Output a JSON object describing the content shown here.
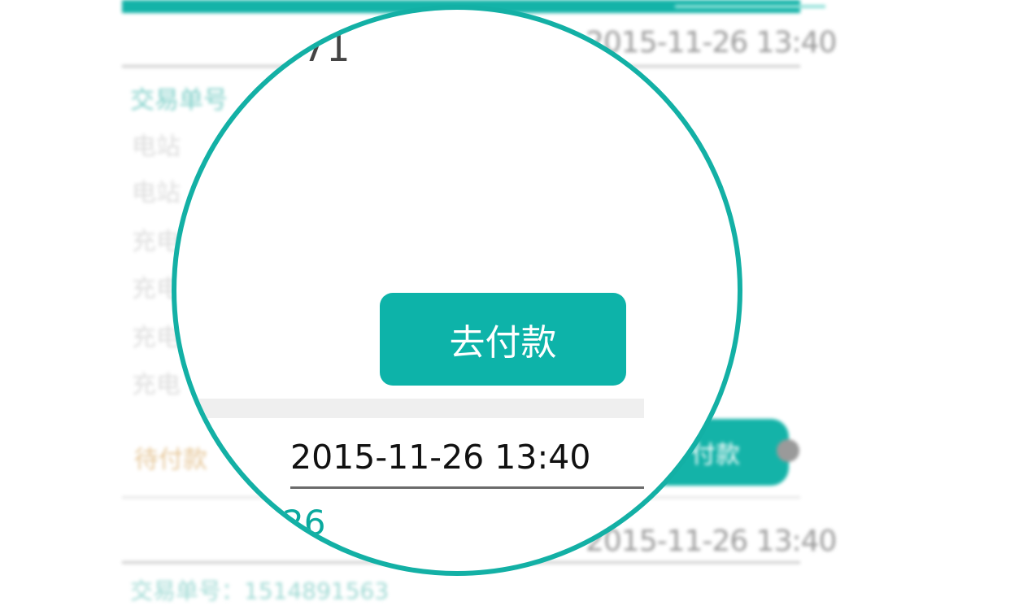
{
  "background": {
    "times": [
      "2015-11-26 13:40",
      "2015-11-26 13:40"
    ],
    "labels": {
      "trade_number": "交易单号",
      "row1": "电站",
      "row2": "电站",
      "row3": "充电",
      "row4": "充电",
      "row5": "充电",
      "row6": "充电",
      "pending_payment": "待付款",
      "bottom_line": "交易单号：1514891563"
    },
    "fragments": {
      "top": "71",
      "bottom": "26"
    },
    "pay_button_label": "付款"
  },
  "lens": {
    "pay_button_label": "去付款",
    "datetime": "2015-11-26 13:40",
    "fragment_top": "71",
    "fragment_bottom": "26"
  },
  "colors": {
    "accent": "#13b0a5",
    "button": "#0db3a9",
    "pending": "#e6c79a"
  }
}
